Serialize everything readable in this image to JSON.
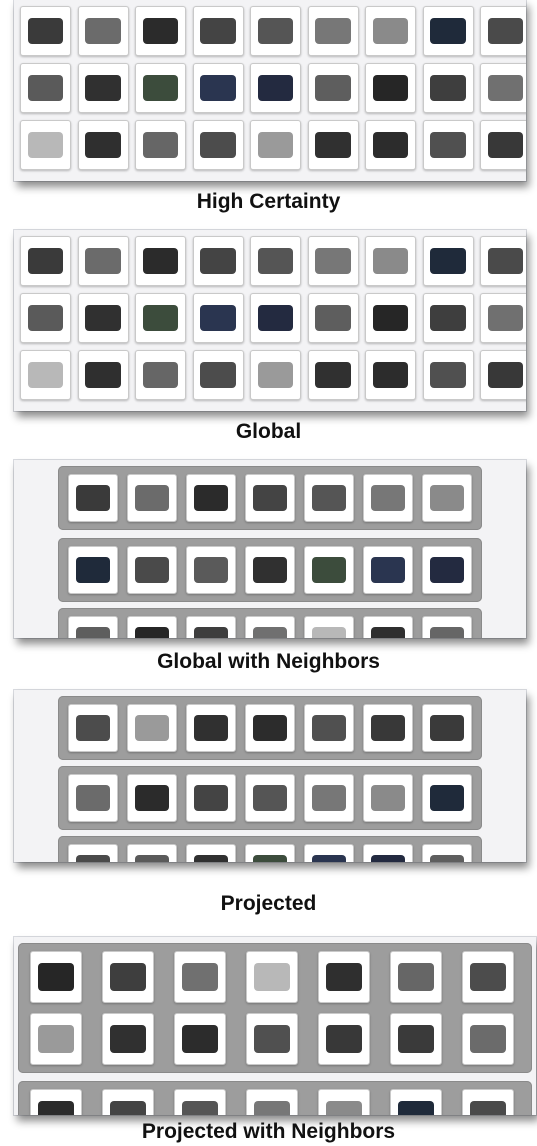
{
  "captions": {
    "high_certainty": "High Certainty",
    "global": "Global",
    "global_with_neighbors": "Global with Neighbors",
    "projected": "Projected",
    "projected_with_neighbors": "Projected with Neighbors"
  },
  "colors": {
    "panel_bg": "#f3f3f5",
    "strip_bg": "#9d9d9d",
    "thumb_bg": "#ffffff",
    "caption_text": "#111111"
  },
  "thumb_tints": [
    "#3a3a3a",
    "#6b6b6b",
    "#2b2b2b",
    "#444444",
    "#555555",
    "#777777",
    "#8a8a8a",
    "#1f2a3a",
    "#4a4a4a",
    "#5a5a5a",
    "#303030",
    "#3c4c3c",
    "#2a3550",
    "#232a40",
    "#5e5e5e",
    "#262626",
    "#3e3e3e",
    "#707070",
    "#b8b8b8",
    "#2f2f2f",
    "#666666",
    "#4c4c4c",
    "#9a9a9a",
    "#303030",
    "#2c2c2c",
    "#505050",
    "#383838"
  ]
}
